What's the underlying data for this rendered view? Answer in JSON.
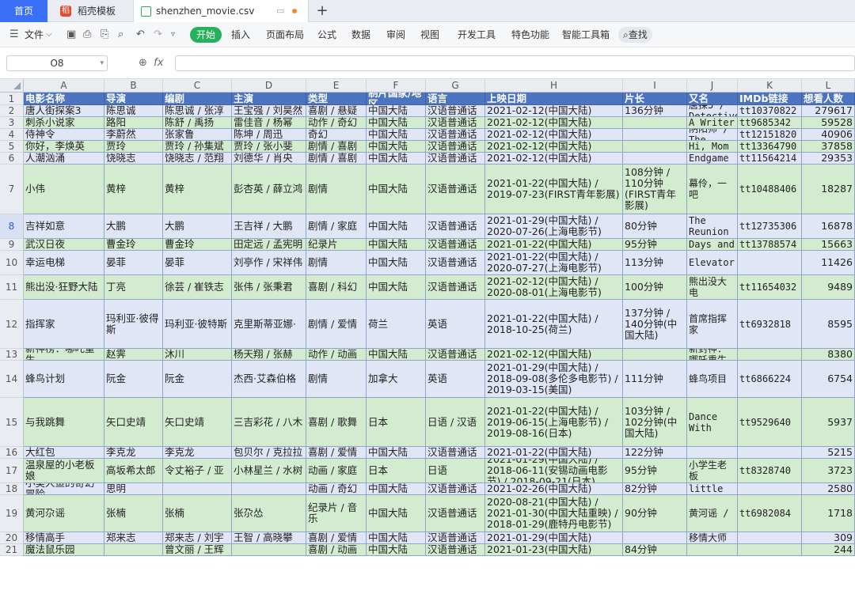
{
  "tabs": {
    "home": "首页",
    "template": "稻壳模板",
    "template_logo": "稻",
    "file": "shenzhen_movie.csv",
    "new": "+"
  },
  "menu": {
    "file": "文件",
    "start": "开始",
    "insert": "插入",
    "page_layout": "页面布局",
    "formula": "公式",
    "data": "数据",
    "review": "审阅",
    "view": "视图",
    "dev_tools": "开发工具",
    "special": "特色功能",
    "smart": "智能工具箱",
    "search": "查找"
  },
  "formula_bar": {
    "cell_ref": "O8",
    "fx": "fx",
    "value": ""
  },
  "columns": [
    "A",
    "B",
    "C",
    "D",
    "E",
    "F",
    "G",
    "H",
    "I",
    "J",
    "K",
    "L"
  ],
  "header": [
    "电影名称",
    "导演",
    "编剧",
    "主演",
    "类型",
    "制片国家/地区",
    "语言",
    "上映日期",
    "片长",
    "又名",
    "IMDb链接",
    "想看人数"
  ],
  "rows": [
    [
      "唐人街探案3",
      "陈思诚",
      "陈思诚 / 张淳",
      "王宝强 / 刘昊然",
      "喜剧 / 悬疑",
      "中国大陆",
      "汉语普通话",
      "2021-02-12(中国大陆)",
      "136分钟",
      "唐探3 / Detective",
      "tt10370822",
      "279617"
    ],
    [
      "刺杀小说家",
      "路阳",
      "陈舒 / 禹扬",
      "雷佳音 / 杨幂",
      "动作 / 奇幻",
      "中国大陆",
      "汉语普通话",
      "2021-02-12(中国大陆)",
      "",
      "A Writer",
      "tt9685342",
      "59528"
    ],
    [
      "侍神令",
      "李蔚然",
      "张家鲁",
      "陈坤 / 周迅",
      "奇幻",
      "中国大陆",
      "汉语普通话",
      "2021-02-12(中国大陆)",
      "",
      "阴阳师 / The",
      "tt12151820",
      "40906"
    ],
    [
      "你好，李焕英",
      "贾玲",
      "贾玲 / 孙集斌",
      "贾玲 / 张小斐",
      "剧情 / 喜剧",
      "中国大陆",
      "汉语普通话",
      "2021-02-12(中国大陆)",
      "",
      "Hi, Mom",
      "tt13364790",
      "37858"
    ],
    [
      "人潮汹涌",
      "饶晓志",
      "饶晓志 / 范翔",
      "刘德华 / 肖央",
      "剧情 / 喜剧",
      "中国大陆",
      "汉语普通话",
      "2021-02-12(中国大陆)",
      "",
      "Endgame",
      "tt11564214",
      "29353"
    ],
    [
      "小伟",
      "黄梓",
      "黄梓",
      "彭杏英 / 薛立鸿",
      "剧情",
      "中国大陆",
      "汉语普通话",
      "2021-01-22(中国大陆) / 2019-07-23(FIRST青年影展)",
      "108分钟 / 110分钟 (FIRST青年影展)",
      "幕伶，一吧",
      "tt10488406",
      "18287"
    ],
    [
      "吉祥如意",
      "大鹏",
      "大鹏",
      "王吉祥 / 大鹏",
      "剧情 / 家庭",
      "中国大陆",
      "汉语普通话",
      "2021-01-29(中国大陆) / 2020-07-26(上海电影节)",
      "80分钟",
      "The Reunion",
      "tt12735306",
      "16878"
    ],
    [
      "武汉日夜",
      "曹金玲",
      "曹金玲",
      "田定远 / 孟宪明",
      "纪录片",
      "中国大陆",
      "汉语普通话",
      "2021-01-22(中国大陆)",
      "95分钟",
      "Days and",
      "tt13788574",
      "15663"
    ],
    [
      "幸运电梯",
      "晏菲",
      "晏菲",
      "刘亭作 / 宋祥伟",
      "剧情",
      "中国大陆",
      "汉语普通话",
      "2021-01-22(中国大陆) / 2020-07-27(上海电影节)",
      "113分钟",
      "Elevator",
      "",
      "11426"
    ],
    [
      "熊出没·狂野大陆",
      "丁亮",
      "徐芸 / 崔铁志",
      "张伟 / 张秉君",
      "喜剧 / 科幻",
      "中国大陆",
      "汉语普通话",
      "2021-02-12(中国大陆) / 2020-08-01(上海电影节)",
      "100分钟",
      "熊出没大电",
      "tt11654032",
      "9489"
    ],
    [
      "指挥家",
      "玛利亚·彼得斯",
      "玛利亚·彼特斯",
      "克里斯蒂亚娜·",
      "剧情 / 爱情",
      "荷兰",
      "英语",
      "2021-01-22(中国大陆) / 2018-10-25(荷兰)",
      "137分钟 / 140分钟(中国大陆)",
      "首席指挥家",
      "tt6932818",
      "8595"
    ],
    [
      "新神榜：哪吒重生",
      "赵霁",
      "沐川",
      "杨天翔 / 张赫",
      "动作 / 动画",
      "中国大陆",
      "汉语普通话",
      "2021-02-12(中国大陆)",
      "",
      "新封神：哪吒重生",
      "",
      "8380"
    ],
    [
      "蜂鸟计划",
      "阮金",
      "阮金",
      "杰西·艾森伯格",
      "剧情",
      "加拿大",
      "英语",
      "2021-01-29(中国大陆) / 2018-09-08(多伦多电影节) / 2019-03-15(美国)",
      "111分钟",
      "蜂鸟项目",
      "tt6866224",
      "6754"
    ],
    [
      "与我跳舞",
      "矢口史靖",
      "矢口史靖",
      "三吉彩花 / 八木",
      "喜剧 / 歌舞",
      "日本",
      "日语 / 汉语",
      "2021-01-22(中国大陆) / 2019-06-15(上海电影节) / 2019-08-16(日本)",
      "103分钟 / 102分钟(中国大陆)",
      "Dance With",
      "tt9529640",
      "5937"
    ],
    [
      "大红包",
      "李克龙",
      "李克龙",
      "包贝尔 / 克拉拉",
      "喜剧 / 爱情",
      "中国大陆",
      "汉语普通话",
      "2021-01-22(中国大陆)",
      "122分钟",
      "",
      "",
      "5215"
    ],
    [
      "温泉屋的小老板娘",
      "高坂希太郎",
      "令丈裕子 / 亚",
      "小林星兰 / 水树",
      "动画 / 家庭",
      "日本",
      "日语",
      "2021-01-29(中国大陆) / 2018-06-11(安锡动画电影节) / 2018-09-21(日本)",
      "95分钟",
      "小学生老板",
      "tt8328740",
      "3723"
    ],
    [
      "小美人鱼的奇幻冒险",
      "思明",
      "",
      "",
      "动画 / 奇幻",
      "中国大陆",
      "汉语普通话",
      "2021-02-26(中国大陆)",
      "82分钟",
      "The new little mermaid",
      "",
      "2580"
    ],
    [
      "黄河尕谣",
      "张楠",
      "张楠",
      "张尕怂",
      "纪录片 / 音乐",
      "中国大陆",
      "汉语普通话",
      "2020-08-21(中国大陆) / 2021-01-30(中国大陆重映) / 2018-01-29(鹿特丹电影节)",
      "90分钟",
      "黄河谣 /",
      "tt6982084",
      "1718"
    ],
    [
      "移情高手",
      "郑来志",
      "郑来志 / 刘宇",
      "王智 / 高晓攀",
      "喜剧 / 爱情",
      "中国大陆",
      "汉语普通话",
      "2021-01-29(中国大陆)",
      "",
      "移情大师",
      "",
      "309"
    ],
    [
      "魔法鼠乐园",
      "",
      "曾文丽 / 王辉",
      "",
      "喜剧 / 动画",
      "中国大陆",
      "汉语普通话",
      "2021-01-23(中国大陆)",
      "84分钟",
      "",
      "",
      "244"
    ]
  ]
}
